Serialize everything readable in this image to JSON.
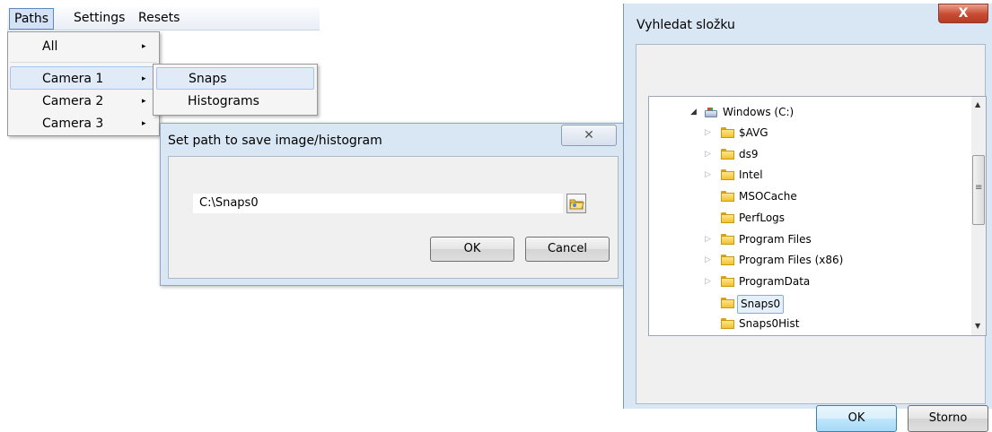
{
  "menubar": {
    "items": [
      "Paths",
      "Settings",
      "Resets"
    ]
  },
  "paths_menu": {
    "items": [
      {
        "label": "All"
      },
      {
        "label": "Camera 1"
      },
      {
        "label": "Camera 2"
      },
      {
        "label": "Camera 3"
      }
    ],
    "submenu_arrow": "▸"
  },
  "camera1_submenu": {
    "items": [
      "Snaps",
      "Histograms"
    ]
  },
  "path_dialog": {
    "title": "Set path to save image/histogram",
    "close_glyph": "✕",
    "path_value": "C:\\Snaps0",
    "ok_label": "OK",
    "cancel_label": "Cancel",
    "browse_icon": "folder-browse-icon"
  },
  "folder_dialog": {
    "title": "Vyhledat složku",
    "close_glyph": "X",
    "root": "Windows (C:)",
    "folders": [
      {
        "name": "$AVG",
        "expandable": true
      },
      {
        "name": "ds9",
        "expandable": true
      },
      {
        "name": "Intel",
        "expandable": true
      },
      {
        "name": "MSOCache",
        "expandable": false
      },
      {
        "name": "PerfLogs",
        "expandable": false
      },
      {
        "name": "Program Files",
        "expandable": true
      },
      {
        "name": "Program Files (x86)",
        "expandable": true
      },
      {
        "name": "ProgramData",
        "expandable": true
      },
      {
        "name": "Snaps0",
        "expandable": false,
        "selected": true
      },
      {
        "name": "Snaps0Hist",
        "expandable": false
      }
    ],
    "ok_label": "OK",
    "cancel_label": "Storno",
    "scroll_grip": "≡"
  },
  "colors": {
    "dialog_frame": "#d9e6f4",
    "menu_highlight": "#e1ebf8",
    "close_red": "#c84b32",
    "folder_yellow": "#f1c232"
  }
}
